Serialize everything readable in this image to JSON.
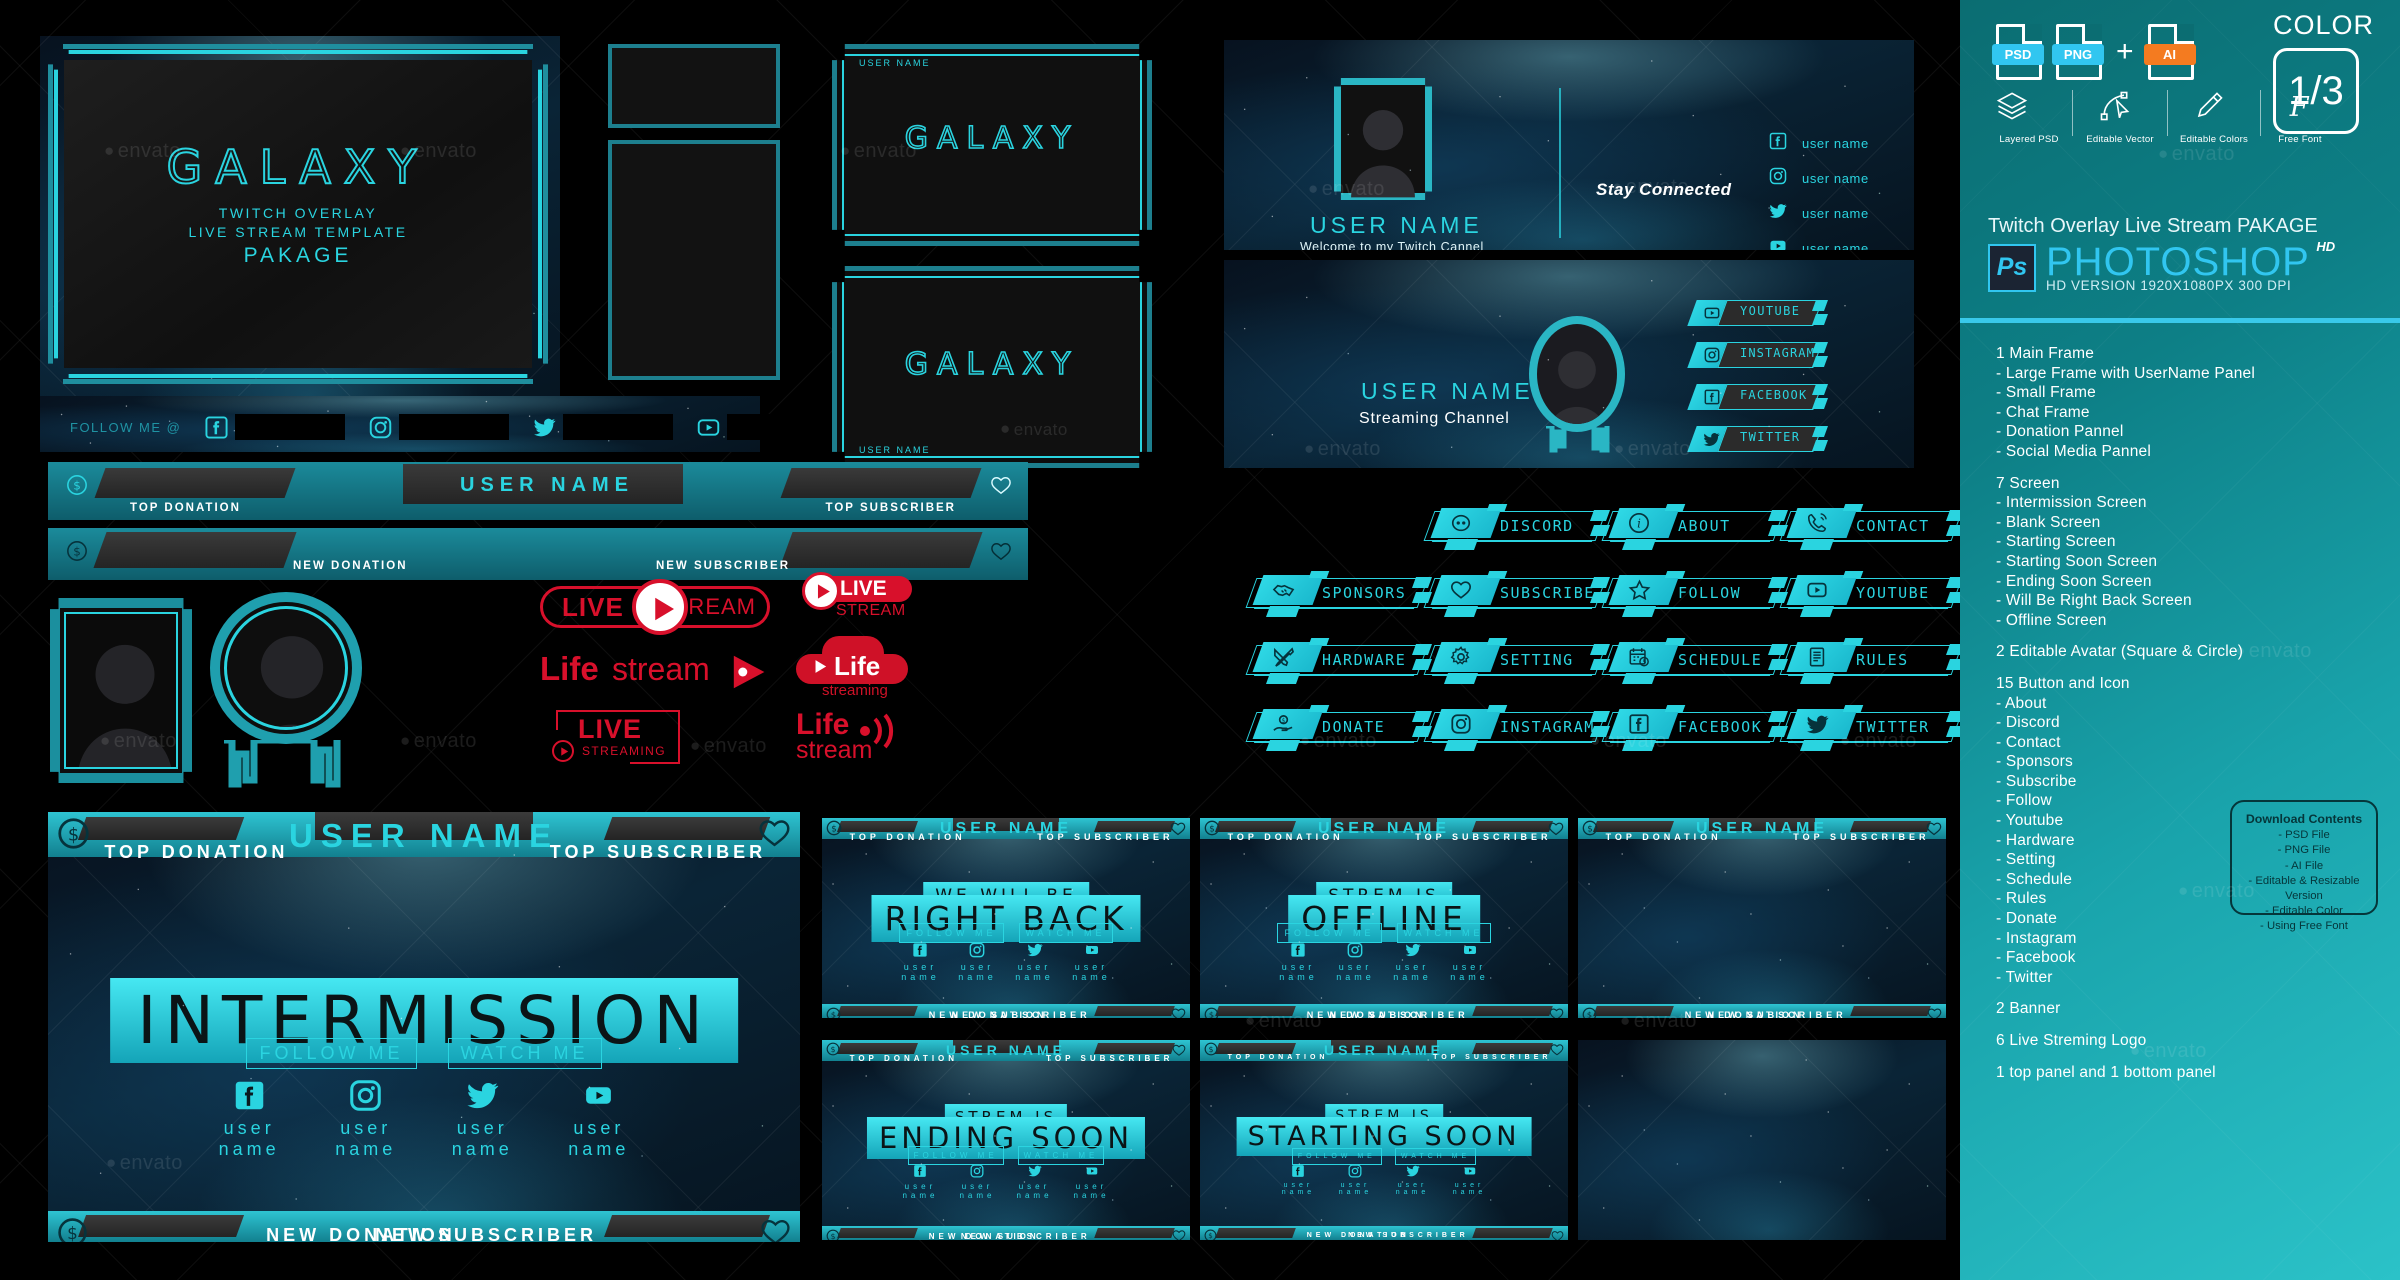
{
  "product": {
    "brand_title": "GALAXY",
    "brand_sub_line1": "TWITCH OVERLAY",
    "brand_sub_line2": "LIVE STREAM TEMPLATE",
    "brand_sub_line3": "PAKAGE",
    "watermark": "envato"
  },
  "colors": {
    "cyan": "#2ad4e0",
    "teal_dark": "#0b6d72",
    "teal_light": "#2bc2c8",
    "red": "#e1112b",
    "ai_orange": "#f47b20",
    "psd_blue": "#31c6f0",
    "divider": "#39c9ea"
  },
  "sidebar": {
    "color_label": "COLOR",
    "color_value": "1/3",
    "file_tags": [
      {
        "label": "PSD",
        "color": "#31c6f0"
      },
      {
        "label": "PNG",
        "color": "#31c6f0"
      },
      {
        "label": "AI",
        "color": "#f47b20"
      }
    ],
    "plus_sign": "+",
    "features": [
      {
        "icon": "layers-icon",
        "label": "Layered PSD"
      },
      {
        "icon": "pen-tool-icon",
        "label": "Editable Vector"
      },
      {
        "icon": "eyedropper-icon",
        "label": "Editable Colors"
      },
      {
        "icon": "font-icon",
        "label": "Free Font"
      }
    ],
    "title": "Twitch Overlay Live Stream PAKAGE",
    "title_bold": "PAKAGE",
    "app_name": "PHOTOSHOP",
    "app_badge": "HD",
    "app_logo": "Ps",
    "version_line": "HD VERSION 1920X1080PX 300 DPI",
    "contents": [
      {
        "type": "head",
        "text": "1 Main Frame"
      },
      {
        "type": "item",
        "text": "- Large Frame with UserName Panel"
      },
      {
        "type": "item",
        "text": "- Small Frame"
      },
      {
        "type": "item",
        "text": "- Chat Frame"
      },
      {
        "type": "item",
        "text": "- Donation Pannel"
      },
      {
        "type": "item",
        "text": "- Social Media Pannel"
      },
      {
        "type": "gap",
        "text": ""
      },
      {
        "type": "head",
        "text": "7 Screen"
      },
      {
        "type": "item",
        "text": "- Intermission Screen"
      },
      {
        "type": "item",
        "text": "- Blank Screen"
      },
      {
        "type": "item",
        "text": "- Starting Screen"
      },
      {
        "type": "item",
        "text": "- Starting Soon Screen"
      },
      {
        "type": "item",
        "text": "- Ending Soon Screen"
      },
      {
        "type": "item",
        "text": "- Will Be Right Back Screen"
      },
      {
        "type": "item",
        "text": "- Offline Screen"
      },
      {
        "type": "gap",
        "text": ""
      },
      {
        "type": "head",
        "text": "2 Editable Avatar (Square & Circle)"
      },
      {
        "type": "gap",
        "text": ""
      },
      {
        "type": "head",
        "text": "15 Button and Icon"
      },
      {
        "type": "item",
        "text": "- About"
      },
      {
        "type": "item",
        "text": "- Discord"
      },
      {
        "type": "item",
        "text": "- Contact"
      },
      {
        "type": "item",
        "text": "- Sponsors"
      },
      {
        "type": "item",
        "text": "- Subscribe"
      },
      {
        "type": "item",
        "text": "- Follow"
      },
      {
        "type": "item",
        "text": "- Youtube"
      },
      {
        "type": "item",
        "text": "- Hardware"
      },
      {
        "type": "item",
        "text": "- Setting"
      },
      {
        "type": "item",
        "text": "- Schedule"
      },
      {
        "type": "item",
        "text": "- Rules"
      },
      {
        "type": "item",
        "text": "- Donate"
      },
      {
        "type": "item",
        "text": "- Instagram"
      },
      {
        "type": "item",
        "text": "- Facebook"
      },
      {
        "type": "item",
        "text": "- Twitter"
      },
      {
        "type": "gap",
        "text": ""
      },
      {
        "type": "head",
        "text": "2 Banner"
      },
      {
        "type": "gap",
        "text": ""
      },
      {
        "type": "head",
        "text": "6 Live Streming Logo"
      },
      {
        "type": "gap",
        "text": ""
      },
      {
        "type": "head",
        "text": "1 top panel and 1 bottom panel"
      }
    ],
    "download_box": {
      "title": "Download Contents",
      "items": [
        "- PSD File",
        "- PNG File",
        "- AI File",
        "- Editable & Resizable Version",
        "- Editable Color",
        "- Using Free Font"
      ]
    }
  },
  "follow_bar": {
    "label": "FOLLOW ME @",
    "networks": [
      "facebook-icon",
      "instagram-icon",
      "twitter-icon",
      "youtube-icon"
    ]
  },
  "donation_panel_top": {
    "username": "USER NAME",
    "left_label": "TOP DONATION",
    "right_label": "TOP SUBSCRIBER",
    "money_icon": "dollar-icon",
    "heart_icon": "heart-icon"
  },
  "donation_panel_bottom": {
    "left_label": "NEW DONATION",
    "right_label": "NEW SUBSCRIBER",
    "money_icon": "dollar-icon",
    "heart_icon": "heart-icon"
  },
  "small_frames": [
    {
      "label_top": "USER NAME",
      "title": "GALAXY",
      "label_bottom": ""
    },
    {
      "label_top": "",
      "title": "GALAXY",
      "label_bottom": "USER NAME"
    }
  ],
  "banner_social": {
    "username": "USER NAME",
    "tagline": "Welcome to my Twitch Cannel",
    "stay_connected": "Stay Connected",
    "rows": [
      {
        "icon": "facebook-icon",
        "text": "user name"
      },
      {
        "icon": "instagram-icon",
        "text": "user name"
      },
      {
        "icon": "twitter-icon",
        "text": "user name"
      },
      {
        "icon": "youtube-icon",
        "text": "user name"
      }
    ]
  },
  "banner_channel": {
    "username": "USER NAME",
    "tagline": "Streaming Channel",
    "buttons": [
      {
        "icon": "youtube-icon",
        "label": "YOUTUBE"
      },
      {
        "icon": "instagram-icon",
        "label": "INSTAGRAM"
      },
      {
        "icon": "facebook-icon",
        "label": "FACEBOOK"
      },
      {
        "icon": "twitter-icon",
        "label": "TWITTER"
      }
    ]
  },
  "buttons_grid": [
    {
      "icon": "sponsors-handshake-icon",
      "label": "SPONSORS",
      "col": 0,
      "row": 1
    },
    {
      "icon": "hardware-tools-icon",
      "label": "HARDWARE",
      "col": 0,
      "row": 2
    },
    {
      "icon": "donate-hand-icon",
      "label": "DONATE",
      "col": 0,
      "row": 3
    },
    {
      "icon": "discord-icon",
      "label": "DISCORD",
      "col": 1,
      "row": 0
    },
    {
      "icon": "subscribe-heart-icon",
      "label": "SUBSCRIBE",
      "col": 1,
      "row": 1
    },
    {
      "icon": "setting-gear-icon",
      "label": "SETTING",
      "col": 1,
      "row": 2
    },
    {
      "icon": "instagram-icon",
      "label": "INSTAGRAM",
      "col": 1,
      "row": 3
    },
    {
      "icon": "about-info-icon",
      "label": "ABOUT",
      "col": 2,
      "row": 0
    },
    {
      "icon": "follow-star-icon",
      "label": "FOLLOW",
      "col": 2,
      "row": 1
    },
    {
      "icon": "schedule-calendar-icon",
      "label": "SCHEDULE",
      "col": 2,
      "row": 2
    },
    {
      "icon": "facebook-icon",
      "label": "FACEBOOK",
      "col": 2,
      "row": 3
    },
    {
      "icon": "contact-phone-icon",
      "label": "CONTACT",
      "col": 3,
      "row": 0
    },
    {
      "icon": "youtube-icon",
      "label": "YOUTUBE",
      "col": 3,
      "row": 1
    },
    {
      "icon": "rules-document-icon",
      "label": "RULES",
      "col": 3,
      "row": 2
    },
    {
      "icon": "twitter-icon",
      "label": "TWITTER",
      "col": 3,
      "row": 3
    }
  ],
  "live_logos": [
    {
      "id": "live-stream-pill",
      "part1": "LIVE",
      "part2": "STREAM"
    },
    {
      "id": "lifestream-wordmark",
      "part1": "Life",
      "part2": "stream"
    },
    {
      "id": "live-streaming-box",
      "part1": "LIVE",
      "part2": "STREAMING"
    },
    {
      "id": "live-stream-badge",
      "part1": "LIVE",
      "part2": "STREAM"
    },
    {
      "id": "life-cloud-logo",
      "part1": "Life",
      "part2": "streaming"
    },
    {
      "id": "life-stream-wifi",
      "part1": "Life",
      "part2": "stream"
    }
  ],
  "screens": {
    "common": {
      "username": "USER NAME",
      "top_donation": "TOP DONATION",
      "top_subscriber": "TOP SUBSCRIBER",
      "new_donation": "NEW DONATION",
      "new_subscriber": "NEW SUBSCRIBER",
      "follow_me": "FOLLOW ME",
      "watch_me": "WATCH ME",
      "social_username": "user name",
      "socials": [
        "facebook-icon",
        "instagram-icon",
        "twitter-icon",
        "youtube-icon"
      ]
    },
    "intermission": {
      "line1": "",
      "line2": "INTERMISSION"
    },
    "right_back": {
      "line1": "WE WILL BE",
      "line2": "RIGHT BACK"
    },
    "offline": {
      "line1": "STREM IS",
      "line2": "OFFLINE"
    },
    "ending_soon": {
      "line1": "STREM IS",
      "line2": "ENDING SOON"
    },
    "starting_soon": {
      "line1": "STREM IS",
      "line2": "STARTING SOON"
    },
    "blank": {
      "line1": "",
      "line2": ""
    }
  }
}
